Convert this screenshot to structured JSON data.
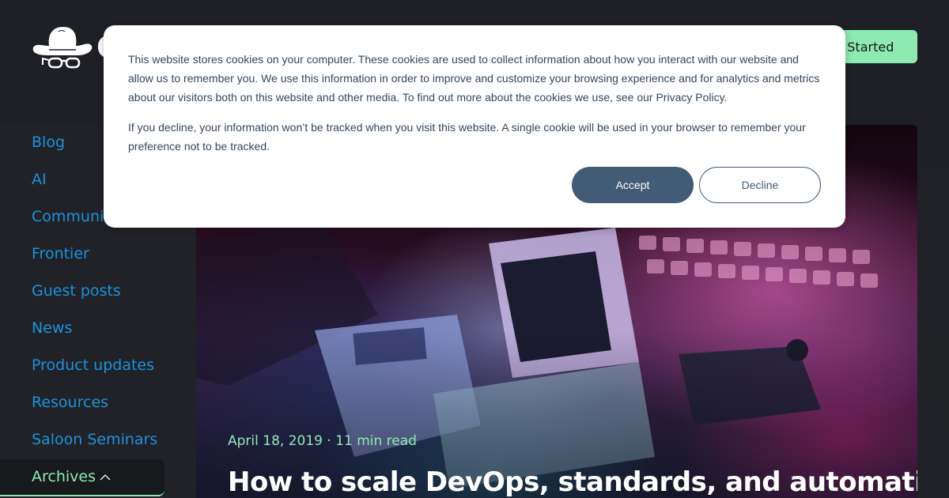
{
  "header": {
    "logo_icon": "cowboy-hat-glasses-icon",
    "cta_label": "Get Started"
  },
  "sidebar": {
    "items": [
      {
        "label": "Blog"
      },
      {
        "label": "AI"
      },
      {
        "label": "Communities"
      },
      {
        "label": "Frontier"
      },
      {
        "label": "Guest posts"
      },
      {
        "label": "News"
      },
      {
        "label": "Product updates"
      },
      {
        "label": "Resources"
      },
      {
        "label": "Saloon Seminars"
      }
    ],
    "archives": {
      "label": "Archives",
      "icon": "chevron-up-icon",
      "expanded": true
    }
  },
  "hero": {
    "meta": "April 18, 2019 · 11 min read",
    "title": "How to scale DevOps, standards, and automation"
  },
  "cookie_banner": {
    "paragraph_1": "This website stores cookies on your computer. These cookies are used to collect information about how you interact with our website and allow us to remember you. We use this information in order to improve and customize your browsing experience and for analytics and metrics about our visitors both on this website and other media. To find out more about the cookies we use, see our Privacy Policy.",
    "paragraph_2": "If you decline, your information won’t be tracked when you visit this website. A single cookie will be used in your browser to remember your preference not to be tracked.",
    "accept_label": "Accept",
    "decline_label": "Decline"
  },
  "colors": {
    "accent_green": "#8debb2",
    "link_blue": "#1a93dc",
    "background": "#202227",
    "modal_text": "#33475b",
    "accept_button": "#425b76"
  }
}
